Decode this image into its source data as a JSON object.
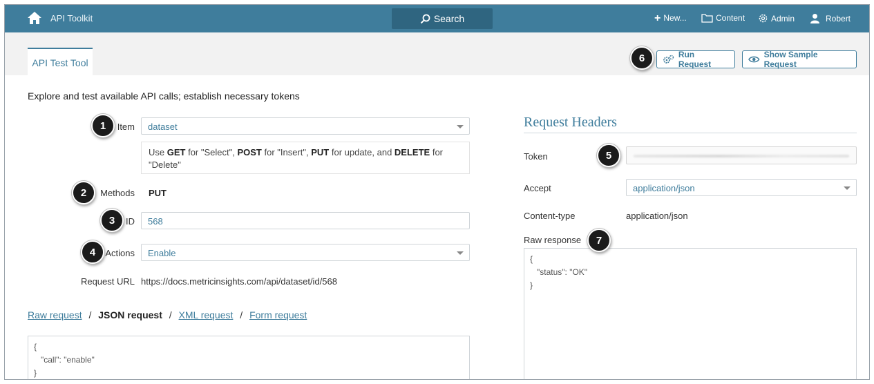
{
  "nav": {
    "brand": "API Toolkit",
    "search": "Search",
    "new": "New...",
    "content": "Content",
    "admin": "Admin",
    "user": "Robert"
  },
  "tab": {
    "label": "API Test Tool"
  },
  "toolbar": {
    "run": "Run Request",
    "sample": "Show Sample Request"
  },
  "badges": [
    "1",
    "2",
    "3",
    "4",
    "5",
    "6",
    "7"
  ],
  "form": {
    "description": "Explore and test available API calls; establish necessary tokens",
    "item_label": "Item",
    "item_value": "dataset",
    "hint": {
      "t1": "Use ",
      "get": "GET",
      "t2": " for \"Select\", ",
      "post": "POST",
      "t3": " for \"Insert\", ",
      "put": "PUT",
      "t4": " for update, and ",
      "del": "DELETE",
      "t5": " for \"Delete\""
    },
    "methods_label": "Methods",
    "methods_value": "PUT",
    "id_label": "ID",
    "id_value": "568",
    "actions_label": "Actions",
    "actions_value": "Enable",
    "url_label": "Request URL",
    "url_value": "https://docs.metricinsights.com/api/dataset/id/568"
  },
  "request_links": {
    "raw": "Raw request",
    "json": "JSON request",
    "xml": "XML request",
    "form": "Form request",
    "sep": "/"
  },
  "request_body": "{\n   \"call\": \"enable\"\n}",
  "headers": {
    "title": "Request Headers",
    "token_label": "Token",
    "accept_label": "Accept",
    "accept_value": "application/json",
    "content_type_label": "Content-type",
    "content_type_value": "application/json",
    "raw_response_label": "Raw response",
    "raw_response": "{\n   \"status\": \"OK\"\n}"
  },
  "colors": {
    "accent": "#3f7d9c",
    "nav_bg": "#3f7d9c",
    "badge": "#1b1b1b"
  }
}
